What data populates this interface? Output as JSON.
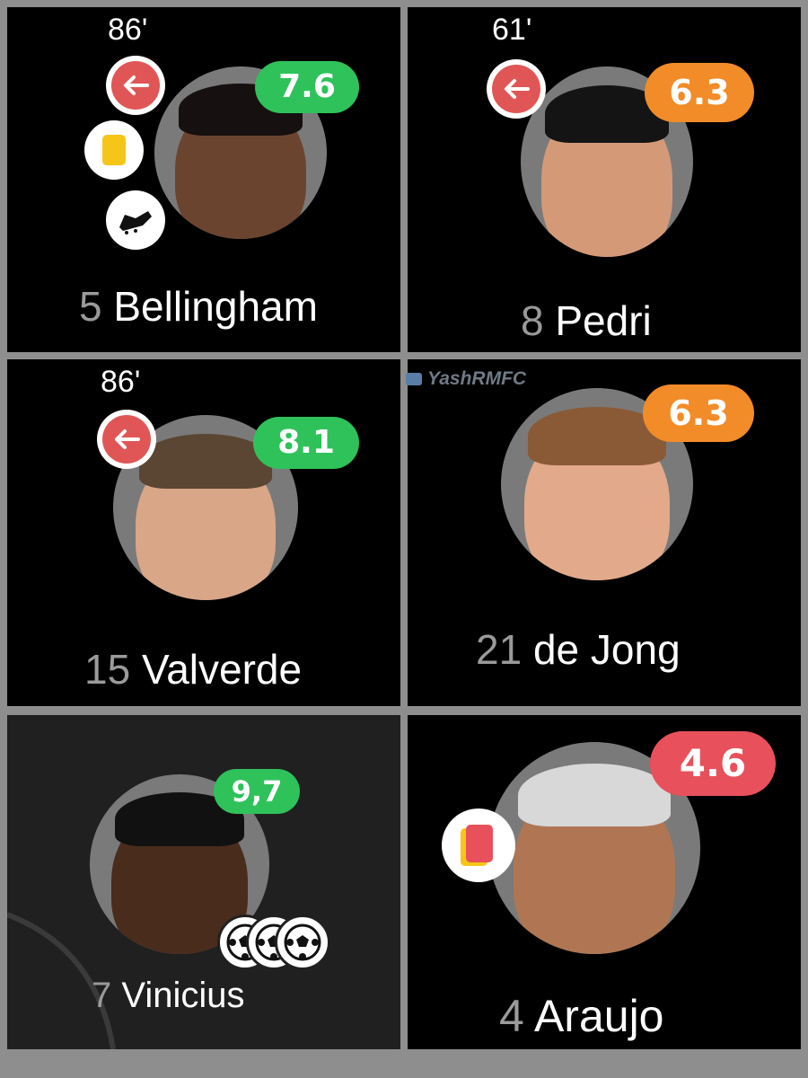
{
  "watermark": "YashRMFC",
  "colors": {
    "rating_green": "#2fc25b",
    "rating_orange": "#f28c28",
    "rating_red": "#e8505b",
    "sub_out_red": "#e05656",
    "yellow_card": "#f5c518",
    "red_card": "#e8505b",
    "avatar_bg": "#7a7a7a",
    "number_grey": "#9a9a9a"
  },
  "players": [
    {
      "number": "5",
      "name": "Bellingham",
      "rating": "7.6",
      "rating_color": "green",
      "minute": "86'",
      "icons": [
        "sub-out-icon",
        "yellow-card-icon",
        "boot-icon"
      ]
    },
    {
      "number": "8",
      "name": "Pedri",
      "rating": "6.3",
      "rating_color": "orange",
      "minute": "61'",
      "icons": [
        "sub-out-icon"
      ]
    },
    {
      "number": "15",
      "name": "Valverde",
      "rating": "8.1",
      "rating_color": "green",
      "minute": "86'",
      "icons": [
        "sub-out-icon"
      ]
    },
    {
      "number": "21",
      "name": "de Jong",
      "rating": "6.3",
      "rating_color": "orange",
      "minute": "",
      "icons": []
    },
    {
      "number": "7",
      "name": "Vinicius",
      "rating": "9,7",
      "rating_color": "green",
      "minute": "",
      "icons": [
        "goal-ball-icon",
        "goal-ball-icon",
        "goal-ball-icon"
      ]
    },
    {
      "number": "4",
      "name": "Araujo",
      "rating": "4.6",
      "rating_color": "red",
      "minute": "",
      "icons": [
        "red-card-icon"
      ]
    }
  ]
}
